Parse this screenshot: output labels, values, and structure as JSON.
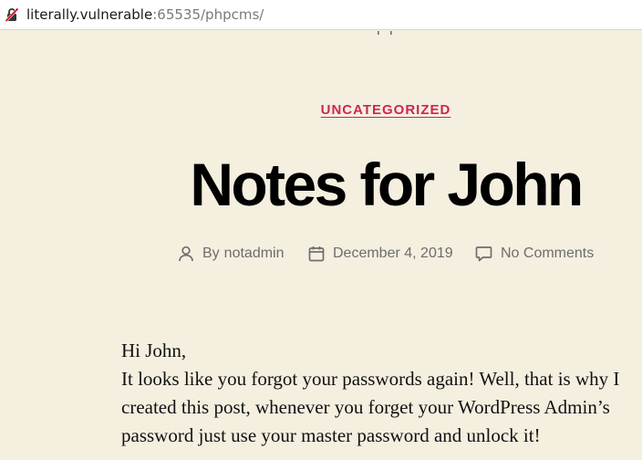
{
  "browser": {
    "url_host": "literally.vulnerable",
    "url_rest": ":65535/phpcms/",
    "insecure_icon": "insecure-lock-icon"
  },
  "post": {
    "category": "UNCATEGORIZED",
    "title": "Notes for John",
    "meta": {
      "by_label": "By",
      "author": "notadmin",
      "date": "December 4, 2019",
      "comments": "No Comments",
      "author_icon": "person-icon",
      "date_icon": "calendar-icon",
      "comments_icon": "comment-icon"
    },
    "body": {
      "line1": "Hi John,",
      "line2": "It looks like you forgot your passwords again! Well, that is why I",
      "line3": "created this post, whenever you forget your WordPress Admin’s",
      "line4": "password just use your master password and unlock it!"
    }
  },
  "colors": {
    "background": "#f5efe0",
    "accent": "#cd2653",
    "meta_text": "#6d6d6d"
  }
}
